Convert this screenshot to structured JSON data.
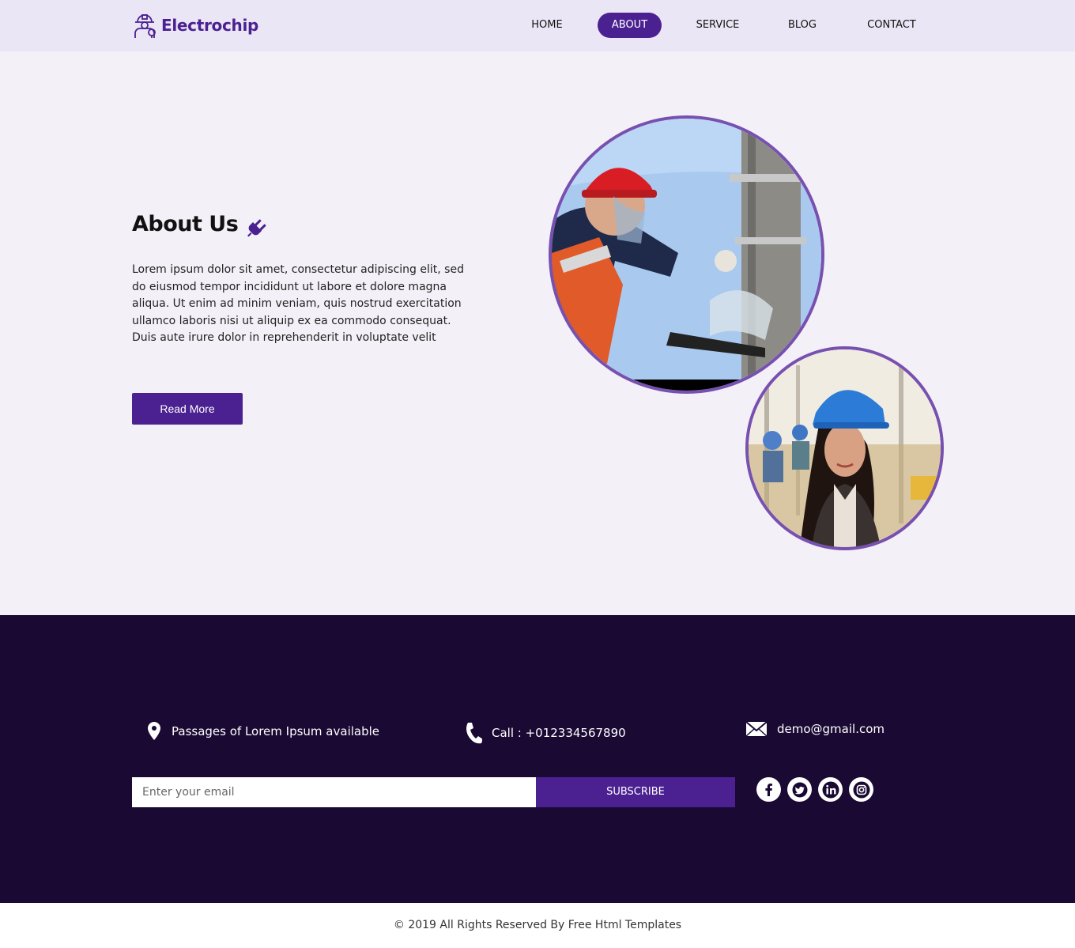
{
  "brand": {
    "name": "Electrochip",
    "logo_icon": "electrician-logo-icon"
  },
  "nav": {
    "items": [
      {
        "label": "HOME",
        "active": false
      },
      {
        "label": "ABOUT",
        "active": true
      },
      {
        "label": "SERVICE",
        "active": false
      },
      {
        "label": "BLOG",
        "active": false
      },
      {
        "label": "CONTACT",
        "active": false
      }
    ]
  },
  "about": {
    "title": "About Us",
    "title_icon": "plug-icon",
    "body": "Lorem ipsum dolor sit amet, consectetur adipiscing elit, sed do eiusmod tempor incididunt ut labore et dolore magna aliqua. Ut enim ad minim veniam, quis nostrud exercitation ullamco laboris nisi ut aliquip ex ea commodo consequat. Duis aute irure dolor in reprehenderit in voluptate velit",
    "button_label": "Read More",
    "images": [
      {
        "name": "electrician-on-pole-photo"
      },
      {
        "name": "woman-hardhat-photo"
      }
    ]
  },
  "contact": {
    "address": "Passages of Lorem Ipsum available",
    "phone": "Call : +012334567890",
    "email": "demo@gmail.com",
    "subscribe": {
      "placeholder": "Enter your email",
      "button_label": "SUBSCRIBE"
    },
    "socials": [
      "facebook-icon",
      "twitter-icon",
      "linkedin-icon",
      "instagram-icon"
    ]
  },
  "footer": {
    "copyright": "© 2019 All Rights Reserved By Free Html Templates"
  },
  "colors": {
    "accent": "#4b2191",
    "header_bg": "#ebe6f5",
    "section_bg": "#f3f0f7",
    "footer_bg": "#190933",
    "circle_border": "#7750b0"
  }
}
